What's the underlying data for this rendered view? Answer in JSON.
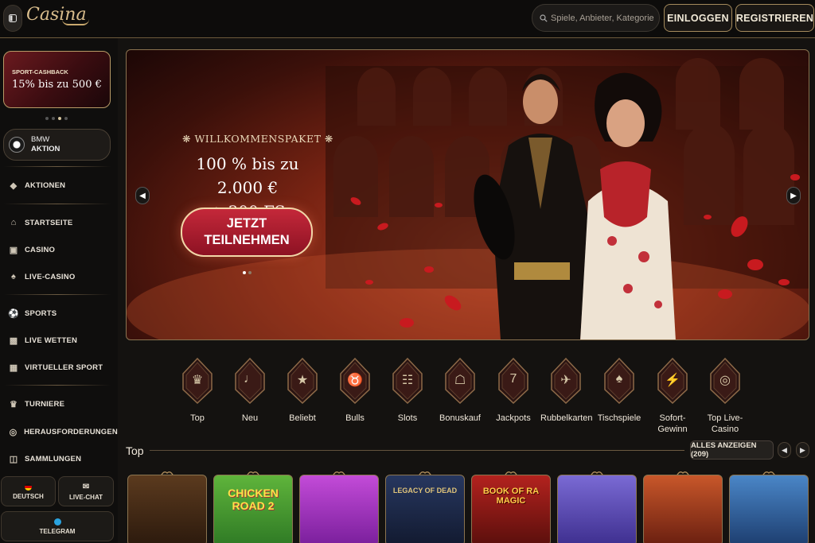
{
  "header": {
    "logo": "Casina",
    "search_placeholder": "Spiele, Anbieter, Kategorien",
    "login_label": "EINLOGGEN",
    "register_label": "REGISTRIEREN"
  },
  "sidebar": {
    "promo": {
      "label": "SPORT-CASHBACK",
      "value": "15% bis zu 500 €"
    },
    "bmw": {
      "line1": "BMW",
      "line2": "AKTION"
    },
    "items": [
      {
        "label": "AKTIONEN",
        "icon": "gift-icon"
      },
      {
        "label": "STARTSEITE",
        "icon": "home-icon"
      },
      {
        "label": "CASINO",
        "icon": "slot-icon"
      },
      {
        "label": "LIVE-CASINO",
        "icon": "cards-icon"
      },
      {
        "label": "SPORTS",
        "icon": "ball-icon"
      },
      {
        "label": "LIVE WETTEN",
        "icon": "live-icon"
      },
      {
        "label": "VIRTUELLER SPORT",
        "icon": "virtual-sport-icon"
      },
      {
        "label": "TURNIERE",
        "icon": "trophy-icon"
      },
      {
        "label": "HERAUSFORDERUNGEN",
        "icon": "target-icon"
      },
      {
        "label": "SAMMLUNGEN",
        "icon": "collection-icon"
      }
    ],
    "language_label": "DEUTSCH",
    "livechat_label": "LIVE-CHAT",
    "telegram_label": "TELEGRAM"
  },
  "banner": {
    "label": "WILLKOMMENSPAKET",
    "headline_1": "100 % bis zu 2.000 €",
    "headline_2": "+ 300 FS",
    "cta_1": "JETZT",
    "cta_2": "TEILNEHMEN"
  },
  "categories": [
    {
      "label": "Top",
      "icon": "crown-icon"
    },
    {
      "label": "Neu",
      "icon": "bell-icon"
    },
    {
      "label": "Beliebt",
      "icon": "star-icon"
    },
    {
      "label": "Bulls",
      "icon": "bull-icon"
    },
    {
      "label": "Slots",
      "icon": "slot-machine-icon"
    },
    {
      "label": "Bonuskauf",
      "icon": "gift-box-icon"
    },
    {
      "label": "Jackpots",
      "icon": "seven-icon"
    },
    {
      "label": "Rubbelkarten",
      "icon": "rocket-icon"
    },
    {
      "label": "Tischspiele",
      "icon": "playing-cards-icon"
    },
    {
      "label": "Sofort-Gewinn",
      "icon": "lightning-icon"
    },
    {
      "label": "Top Live-Casino",
      "icon": "chip-icon"
    }
  ],
  "top_section": {
    "title": "Top",
    "show_all_label": "ALLES ANZEIGEN (209)"
  },
  "games": [
    {
      "title": ""
    },
    {
      "title": "CHICKEN ROAD 2"
    },
    {
      "title": ""
    },
    {
      "title": "LEGACY OF DEAD"
    },
    {
      "title": "BOOK OF RA MAGIC"
    },
    {
      "title": ""
    },
    {
      "title": ""
    },
    {
      "title": ""
    }
  ],
  "colors": {
    "gold": "#c9a96e",
    "cta_red": "#b21f32",
    "background": "#141210"
  }
}
